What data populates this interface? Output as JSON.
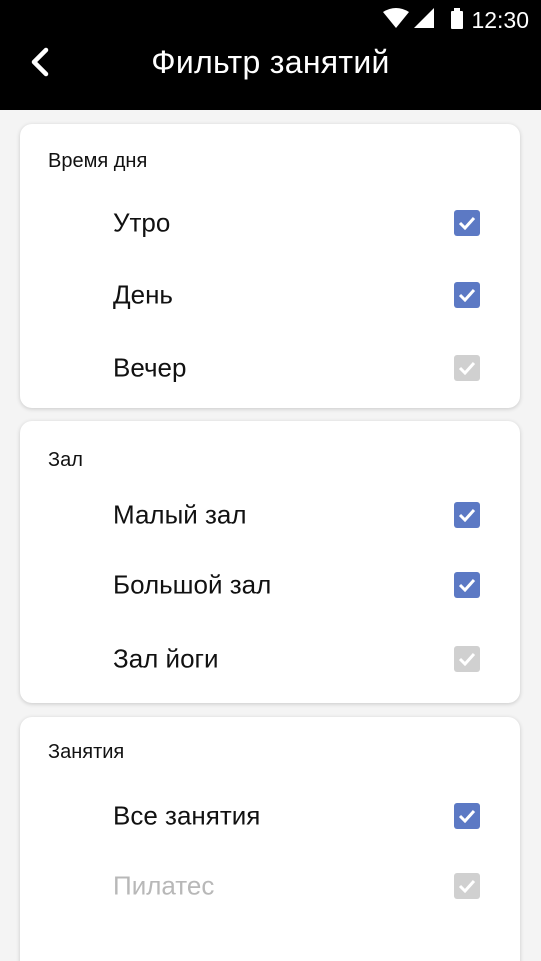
{
  "status_bar": {
    "time": "12:30",
    "icons": [
      "wifi-icon",
      "signal-icon",
      "battery-icon"
    ]
  },
  "toolbar": {
    "back_icon": "chevron-left-icon",
    "title": "Фильтр занятий"
  },
  "colors": {
    "appbar": "#000000",
    "checkbox_checked": "#5c79c4",
    "checkbox_disabled": "#d0d0d0",
    "text_disabled": "#b8b8b8"
  },
  "sections": [
    {
      "title": "Время дня",
      "items": [
        {
          "label": "Утро",
          "checked": true,
          "enabled": true
        },
        {
          "label": "День",
          "checked": true,
          "enabled": true
        },
        {
          "label": "Вечер",
          "checked": true,
          "enabled": false
        }
      ]
    },
    {
      "title": "Зал",
      "items": [
        {
          "label": "Малый зал",
          "checked": true,
          "enabled": true
        },
        {
          "label": "Большой зал",
          "checked": true,
          "enabled": true
        },
        {
          "label": "Зал йоги",
          "checked": true,
          "enabled": false
        }
      ]
    },
    {
      "title": "Занятия",
      "items": [
        {
          "label": "Все занятия",
          "checked": true,
          "enabled": true
        },
        {
          "label": "Пилатес",
          "checked": true,
          "enabled": false
        }
      ]
    }
  ]
}
